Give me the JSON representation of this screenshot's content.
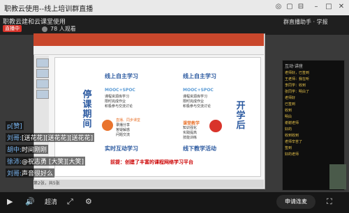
{
  "window": {
    "title": "职教云使用--线上培训群直播",
    "btn_min": "–",
    "btn_max": "□",
    "btn_close": "✕",
    "btn_a": "◎",
    "btn_b": "▢",
    "btn_c": "⊟"
  },
  "header": {
    "brand": "职教云建和云课堂使用",
    "live_badge": "直播中",
    "viewers": "78 人观看",
    "right": "群直播助手 · 学报"
  },
  "ppt": {
    "status": "第2张，共5张"
  },
  "slide": {
    "left_vertical": "停课期间",
    "right_vertical": "开学后",
    "tl_title": "线上自主学习",
    "tl_mooc": "MOOC+SPOC",
    "tl_items": [
      "课程资源库学习",
      "限时完成作业",
      "积极参与交流讨论"
    ],
    "bl_items": [
      "直播、同步课堂",
      "录播分享",
      "答疑解惑",
      "问题交流"
    ],
    "bl_title": "实时互动学习",
    "tr_title": "线上自主学习",
    "tr_mooc": "MOOC+SPOC",
    "tr_items": [
      "课程资源库学习",
      "限时完成作业",
      "积极参与交流讨论"
    ],
    "br_badge": "课堂教学",
    "br_items": [
      "知识强化",
      "实践提高",
      "技能训练"
    ],
    "br_title": "线下教学活动",
    "bottom": "前提：创建了丰富的课程网络学习平台"
  },
  "chat_panel": {
    "header": "互动·讲座",
    "lines": [
      "老师好，已签到",
      "王老师：我在听",
      "李同学：收到",
      "张同学：明白了",
      "老师好",
      "已签到",
      "收到",
      "明白",
      "谢谢老师",
      "好的",
      "收到收到",
      "老师辛苦了",
      "签到",
      "好的老师"
    ]
  },
  "overlay": [
    {
      "name": "p[赞]",
      "msg": ""
    },
    {
      "name": "刘哥:",
      "msg": "[送花花][送花花][送花花]"
    },
    {
      "name": "胡中:",
      "msg": "时间刚刚"
    },
    {
      "name": "徐沛:",
      "msg": "@祝志勇 [大笑][大笑]"
    },
    {
      "name": "刘哥:",
      "msg": "声音很好么"
    }
  ],
  "bottombar": {
    "quality": "超清",
    "join": "申请连麦",
    "play": "▶",
    "volume": "🔊",
    "settings": "⚙",
    "fullscreen": "⛶",
    "share": "⤢"
  }
}
